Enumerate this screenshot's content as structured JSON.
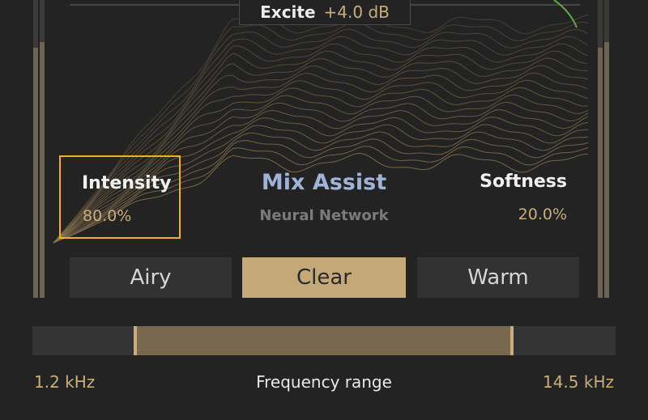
{
  "excite": {
    "label": "Excite",
    "value": "+4.0 dB"
  },
  "intensity": {
    "label": "Intensity",
    "value": "80.0%"
  },
  "softness": {
    "label": "Softness",
    "value": "20.0%"
  },
  "mix_assist": {
    "title": "Mix Assist",
    "subtitle": "Neural Network"
  },
  "modes": [
    {
      "label": "Airy",
      "selected": false
    },
    {
      "label": "Clear",
      "selected": true
    },
    {
      "label": "Warm",
      "selected": false
    }
  ],
  "frequency": {
    "label": "Frequency range",
    "low_label": "1.2 kHz",
    "high_label": "14.5 kHz",
    "range_fraction": [
      0.177,
      0.822
    ]
  },
  "colors": {
    "accent_gold": "#c9ad7a",
    "selected_button": "#c4a878",
    "title_blue": "#9fb2d8",
    "highlight_box": "#f4b400",
    "curve_green": "#5fa84a"
  }
}
